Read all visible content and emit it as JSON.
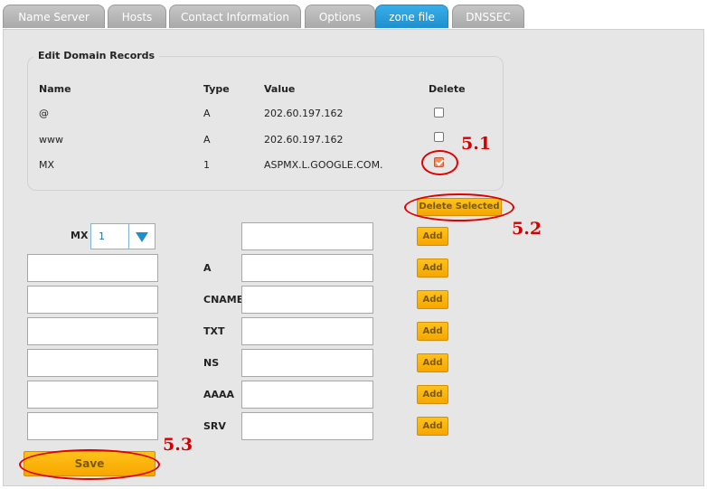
{
  "tabs": [
    {
      "label": "Name Server",
      "active": false
    },
    {
      "label": "Hosts",
      "active": false
    },
    {
      "label": "Contact Information",
      "active": false
    },
    {
      "label": "Options",
      "active": false
    },
    {
      "label": "zone file",
      "active": true
    },
    {
      "label": "DNSSEC",
      "active": false
    }
  ],
  "records": {
    "title": "Edit Domain Records",
    "headers": {
      "name": "Name",
      "type": "Type",
      "value": "Value",
      "delete": "Delete"
    },
    "rows": [
      {
        "name": "@",
        "type": "A",
        "value": "202.60.197.162",
        "delete_checked": false
      },
      {
        "name": "www",
        "type": "A",
        "value": "202.60.197.162",
        "delete_checked": false
      },
      {
        "name": "MX",
        "type": "1",
        "value": "ASPMX.L.GOOGLE.COM.",
        "delete_checked": true
      }
    ],
    "delete_selected_label": "Delete Selected"
  },
  "add_form": {
    "mx_label": "MX",
    "mx_priority_selected": "1",
    "rows": [
      {
        "type": "A"
      },
      {
        "type": "CNAME"
      },
      {
        "type": "TXT"
      },
      {
        "type": "NS"
      },
      {
        "type": "AAAA"
      },
      {
        "type": "SRV"
      }
    ],
    "add_label": "Add",
    "save_label": "Save"
  },
  "annotations": {
    "step1": "5.1",
    "step2": "5.2",
    "step3": "5.3"
  },
  "colors": {
    "active_tab": "#1d8fd0",
    "inactive_tab": "#b3b3b3",
    "button": "#f7a600",
    "annotation_red": "#e00000",
    "panel_bg": "#e6e6e6"
  }
}
